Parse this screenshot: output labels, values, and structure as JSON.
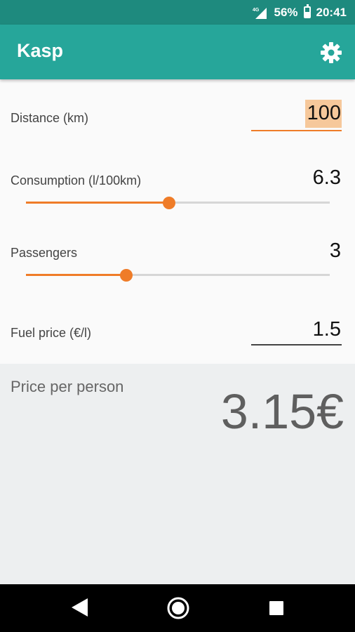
{
  "status_bar": {
    "network": "4G",
    "battery_percent": "56%",
    "time": "20:41",
    "battery_level": 0.56
  },
  "app_bar": {
    "title": "Kasp",
    "settings_icon": "gear-icon"
  },
  "form": {
    "distance": {
      "label": "Distance (km)",
      "value": "100"
    },
    "consumption": {
      "label": "Consumption (l/100km)",
      "value": "6.3",
      "slider_fraction": 0.47
    },
    "passengers": {
      "label": "Passengers",
      "value": "3",
      "slider_fraction": 0.33
    },
    "fuel_price": {
      "label": "Fuel price (€/l)",
      "value": "1.5"
    }
  },
  "result": {
    "label": "Price per person",
    "value": "3.15€"
  },
  "colors": {
    "status_bar": "#1e8a7e",
    "app_bar": "#26a69a",
    "accent": "#ef7c28",
    "selection": "#f6c89b",
    "result_bg": "#edeff0"
  },
  "nav_bar": {
    "back_icon": "back-triangle-icon",
    "home_icon": "home-circle-icon",
    "recents_icon": "recents-square-icon"
  }
}
